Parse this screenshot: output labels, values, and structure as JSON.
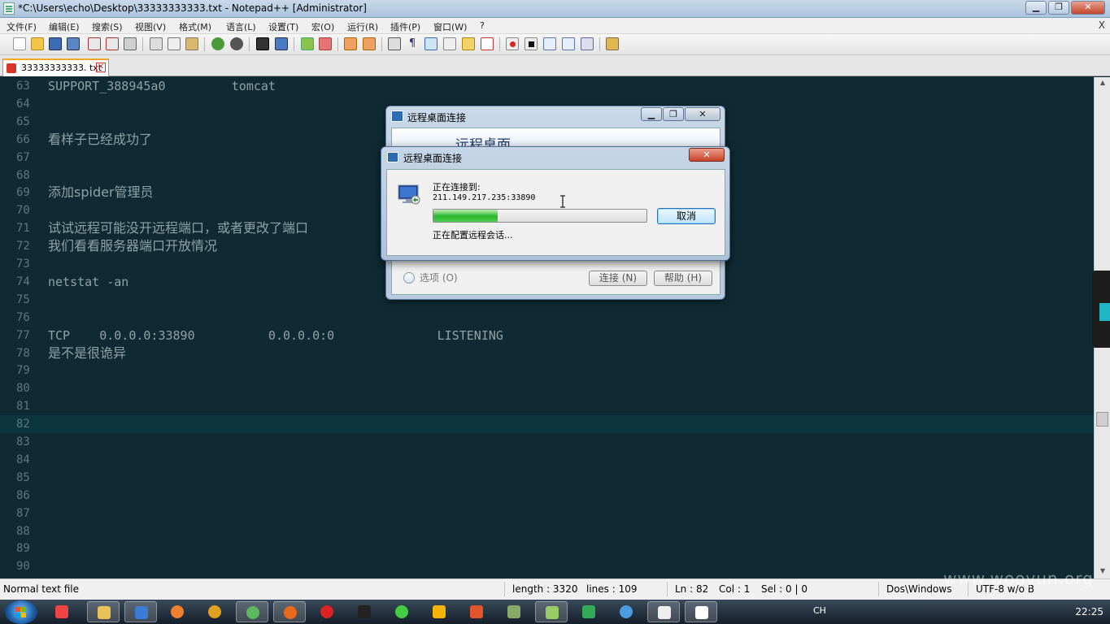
{
  "window": {
    "title": "*C:\\Users\\echo\\Desktop\\33333333333.txt - Notepad++ [Administrator]",
    "minimize": "▁",
    "restore": "❐",
    "close": "✕"
  },
  "menu": {
    "items": [
      "文件(F)",
      "编辑(E)",
      "搜索(S)",
      "视图(V)",
      "格式(M)",
      "语言(L)",
      "设置(T)",
      "宏(O)",
      "运行(R)",
      "插件(P)",
      "窗口(W)",
      "?"
    ],
    "close_x": "X"
  },
  "tab": {
    "label": "33333333333. txt",
    "close": "✕"
  },
  "editor": {
    "lines": [
      {
        "n": "63",
        "t": "SUPPORT_388945a0         tomcat"
      },
      {
        "n": "64",
        "t": ""
      },
      {
        "n": "65",
        "t": ""
      },
      {
        "n": "66",
        "t": "看样子已经成功了"
      },
      {
        "n": "67",
        "t": ""
      },
      {
        "n": "68",
        "t": ""
      },
      {
        "n": "69",
        "t": "添加spider管理员"
      },
      {
        "n": "70",
        "t": ""
      },
      {
        "n": "71",
        "t": "试试远程可能没开远程端口，或者更改了端口"
      },
      {
        "n": "72",
        "t": "我们看看服务器端口开放情况"
      },
      {
        "n": "73",
        "t": ""
      },
      {
        "n": "74",
        "t": "netstat -an"
      },
      {
        "n": "75",
        "t": ""
      },
      {
        "n": "76",
        "t": ""
      },
      {
        "n": "77",
        "t": "TCP    0.0.0.0:33890          0.0.0.0:0              LISTENING"
      },
      {
        "n": "78",
        "t": "是不是很诡异"
      },
      {
        "n": "79",
        "t": ""
      },
      {
        "n": "80",
        "t": ""
      },
      {
        "n": "81",
        "t": ""
      },
      {
        "n": "82",
        "t": ""
      },
      {
        "n": "83",
        "t": ""
      },
      {
        "n": "84",
        "t": ""
      },
      {
        "n": "85",
        "t": ""
      },
      {
        "n": "86",
        "t": ""
      },
      {
        "n": "87",
        "t": ""
      },
      {
        "n": "88",
        "t": ""
      },
      {
        "n": "89",
        "t": ""
      },
      {
        "n": "90",
        "t": ""
      }
    ],
    "current_line": "82"
  },
  "status": {
    "file_type": "Normal text file",
    "length": "length : 3320",
    "lines": "lines : 109",
    "ln": "Ln : 82",
    "col": "Col : 1",
    "sel": "Sel : 0 | 0",
    "eol": "Dos\\Windows",
    "encoding": "UTF-8 w/o B"
  },
  "rdp_back": {
    "title": "远程桌面连接",
    "banner": "远程桌面",
    "options": "选项 (O)",
    "connect": "连接 (N)",
    "help": "帮助 (H)",
    "minimize": "▁",
    "restore": "❐",
    "close": "✕"
  },
  "rdp_front": {
    "title": "远程桌面连接",
    "connecting_label": "正在连接到:",
    "address": "211.149.217.235:33890",
    "cancel": "取消",
    "status": "正在配置远程会话...",
    "progress": 0.3,
    "close": "✕"
  },
  "tray": {
    "lang": "CH",
    "time": "22:25"
  },
  "watermark": "www.wooyun.org",
  "icons": {
    "start": "windows-start-icon",
    "colors": {
      "editor_bg": "#0f2a33",
      "editor_text": "#8fa2a8",
      "progress": "#28b62c",
      "tab_accent": "#f5a623"
    }
  }
}
